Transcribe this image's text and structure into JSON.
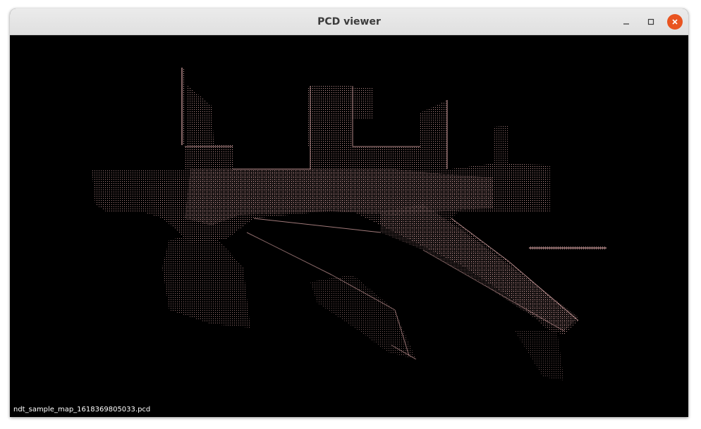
{
  "window": {
    "title": "PCD viewer",
    "controls": {
      "minimize_icon": "minimize-icon",
      "maximize_icon": "maximize-icon",
      "close_icon": "close-icon"
    }
  },
  "viewer": {
    "background_color": "#000000",
    "point_color": "#c89898",
    "file_label": "ndt_sample_map_1618369805033.pcd"
  }
}
